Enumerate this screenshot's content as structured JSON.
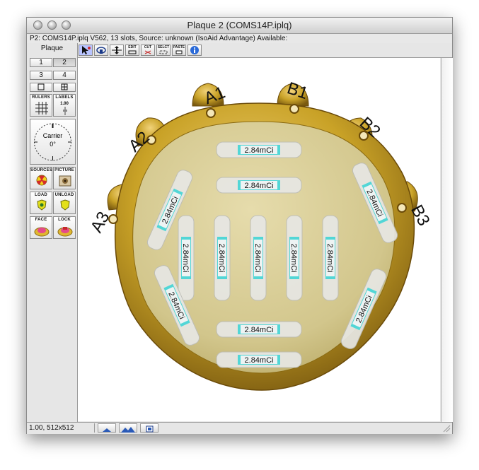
{
  "window": {
    "title": "Plaque 2 (COMS14P.iplq)",
    "info": "P2: COMS14P.iplq V562, 13 slots, Source: unknown (IsoAid Advantage) Available:"
  },
  "left_panel": {
    "plaque_label": "Plaque",
    "plaque_buttons": [
      "1",
      "2",
      "3",
      "4"
    ],
    "selected_plaque": "2",
    "tools": {
      "rulers": "RULERS",
      "labels": "LABELS",
      "labels_value": "1.00",
      "carrier_label": "Carrier",
      "carrier_angle": "0°",
      "sources": "SOURCES",
      "picture": "PICTURE",
      "load": "LOAD",
      "unload": "UNLOAD",
      "face": "FACE",
      "lock": "LOCK"
    }
  },
  "toolbar": {
    "edit": "EDIT",
    "cut": "CUT",
    "select": "SELCT",
    "paste": "PASTE"
  },
  "canvas": {
    "eyelet_labels": [
      "A1",
      "B1",
      "A2",
      "B2",
      "A3",
      "B3"
    ],
    "seeds": [
      "2.84mCi",
      "2.84mCi",
      "2.84mCi",
      "2.84mCi",
      "2.84mCi",
      "2.84mCi",
      "2.84mCi",
      "2.84mCi",
      "2.84mCi",
      "2.84mCi",
      "2.84mCi",
      "2.84mCi",
      "2.84mCi"
    ]
  },
  "status": {
    "text": "1.00, 512x512"
  },
  "colors": {
    "gold": "#c9a227",
    "gold_dark": "#8a6a12",
    "plaque_fill": "#d8cc96",
    "seed_accent": "#4fd8d8"
  }
}
